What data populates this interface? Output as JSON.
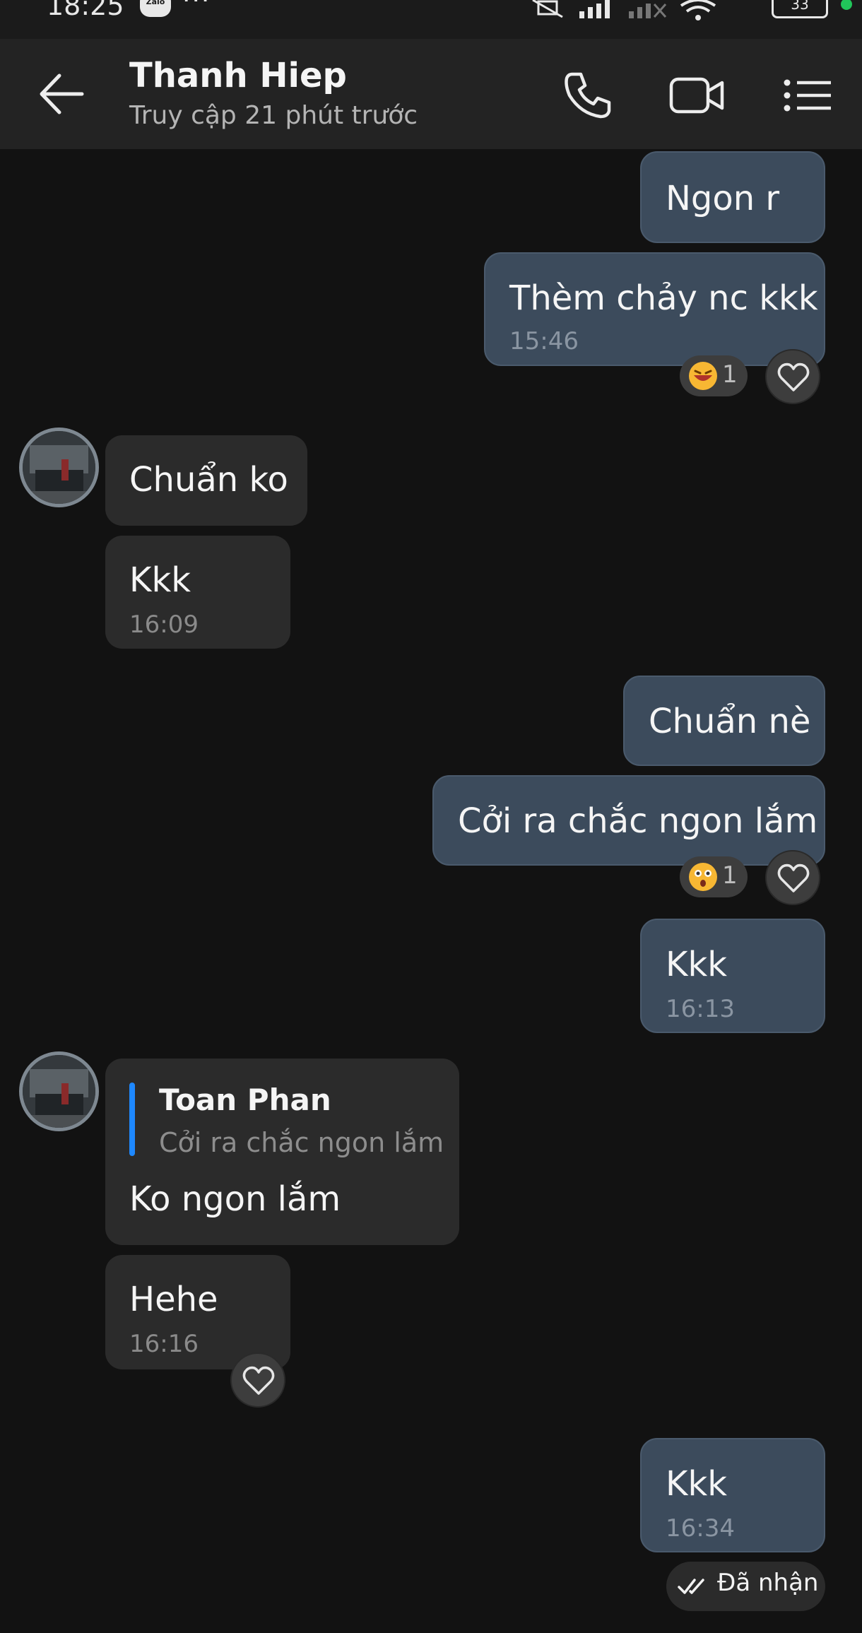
{
  "status_bar": {
    "time": "18:25",
    "app_badge": "Zalo",
    "dots": "···",
    "battery": "33"
  },
  "header": {
    "contact_name": "Thanh Hiep",
    "last_seen": "Truy cập 21 phút trước"
  },
  "messages": [
    {
      "dir": "out",
      "text": "Ngon r"
    },
    {
      "dir": "out",
      "text": "Thèm chảy nc kkk",
      "time": "15:46",
      "reaction_count": "1"
    },
    {
      "dir": "in",
      "text": "Chuẩn ko"
    },
    {
      "dir": "in",
      "text": "Kkk",
      "time": "16:09"
    },
    {
      "dir": "out",
      "text": "Chuẩn nè"
    },
    {
      "dir": "out",
      "text": "Cởi ra chắc ngon lắm",
      "reaction_count": "1"
    },
    {
      "dir": "out",
      "text": "Kkk",
      "time": "16:13"
    },
    {
      "dir": "in",
      "quote_name": "Toan Phan",
      "quote_text": "Cởi ra chắc ngon lắm",
      "text": "Ko ngon lắm"
    },
    {
      "dir": "in",
      "text": "Hehe",
      "time": "16:16"
    },
    {
      "dir": "out",
      "text": "Kkk",
      "time": "16:34"
    }
  ],
  "delivery_status": "Đã nhận"
}
